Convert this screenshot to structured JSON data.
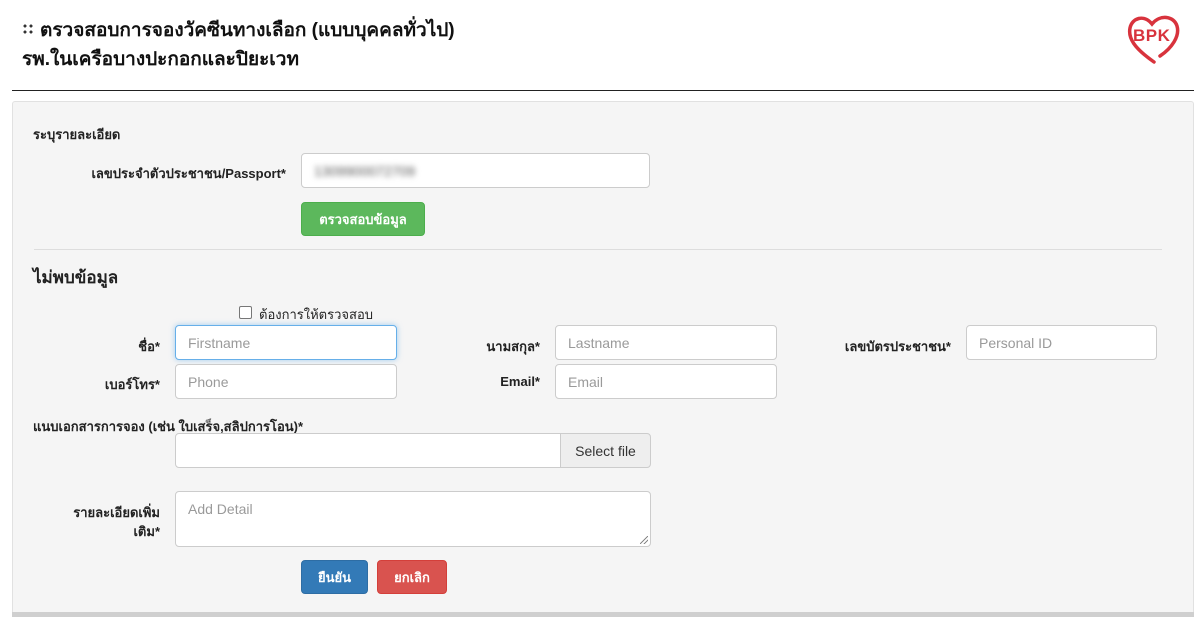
{
  "header": {
    "title_line1": "ตรวจสอบการจองวัคซีนทางเลือก (แบบบุคคลทั่วไป)",
    "title_line2": "รพ.ในเครือบางปะกอกและปิยะเวท",
    "logo_text": "BPK"
  },
  "lookup": {
    "section_label": "ระบุรายละเอียด",
    "id_label": "เลขประจำตัวประชาชน/Passport*",
    "id_value": "1309900072709",
    "check_button": "ตรวจสอบข้อมูล"
  },
  "not_found": {
    "title": "ไม่พบข้อมูล",
    "checkbox_label": "ต้องการให้ตรวจสอบ",
    "fields": {
      "firstname_label": "ชื่อ*",
      "firstname_placeholder": "Firstname",
      "lastname_label": "นามสกุล*",
      "lastname_placeholder": "Lastname",
      "personal_id_label": "เลขบัตรประชาชน*",
      "personal_id_placeholder": "Personal ID",
      "phone_label": "เบอร์โทร*",
      "phone_placeholder": "Phone",
      "email_label": "Email*",
      "email_placeholder": "Email"
    },
    "attachment_label": "แนบเอกสารการจอง (เช่น ใบเสร็จ,สลิปการโอน)*",
    "select_file": "Select file",
    "detail_label_line1": "รายละเอียดเพิ่ม",
    "detail_label_line2": "เติม*",
    "detail_placeholder": "Add Detail",
    "confirm_button": "ยืนยัน",
    "cancel_button": "ยกเลิก"
  },
  "colors": {
    "success": "#5cb85c",
    "primary": "#337ab7",
    "danger": "#d9534f",
    "logo": "#d8333d"
  }
}
